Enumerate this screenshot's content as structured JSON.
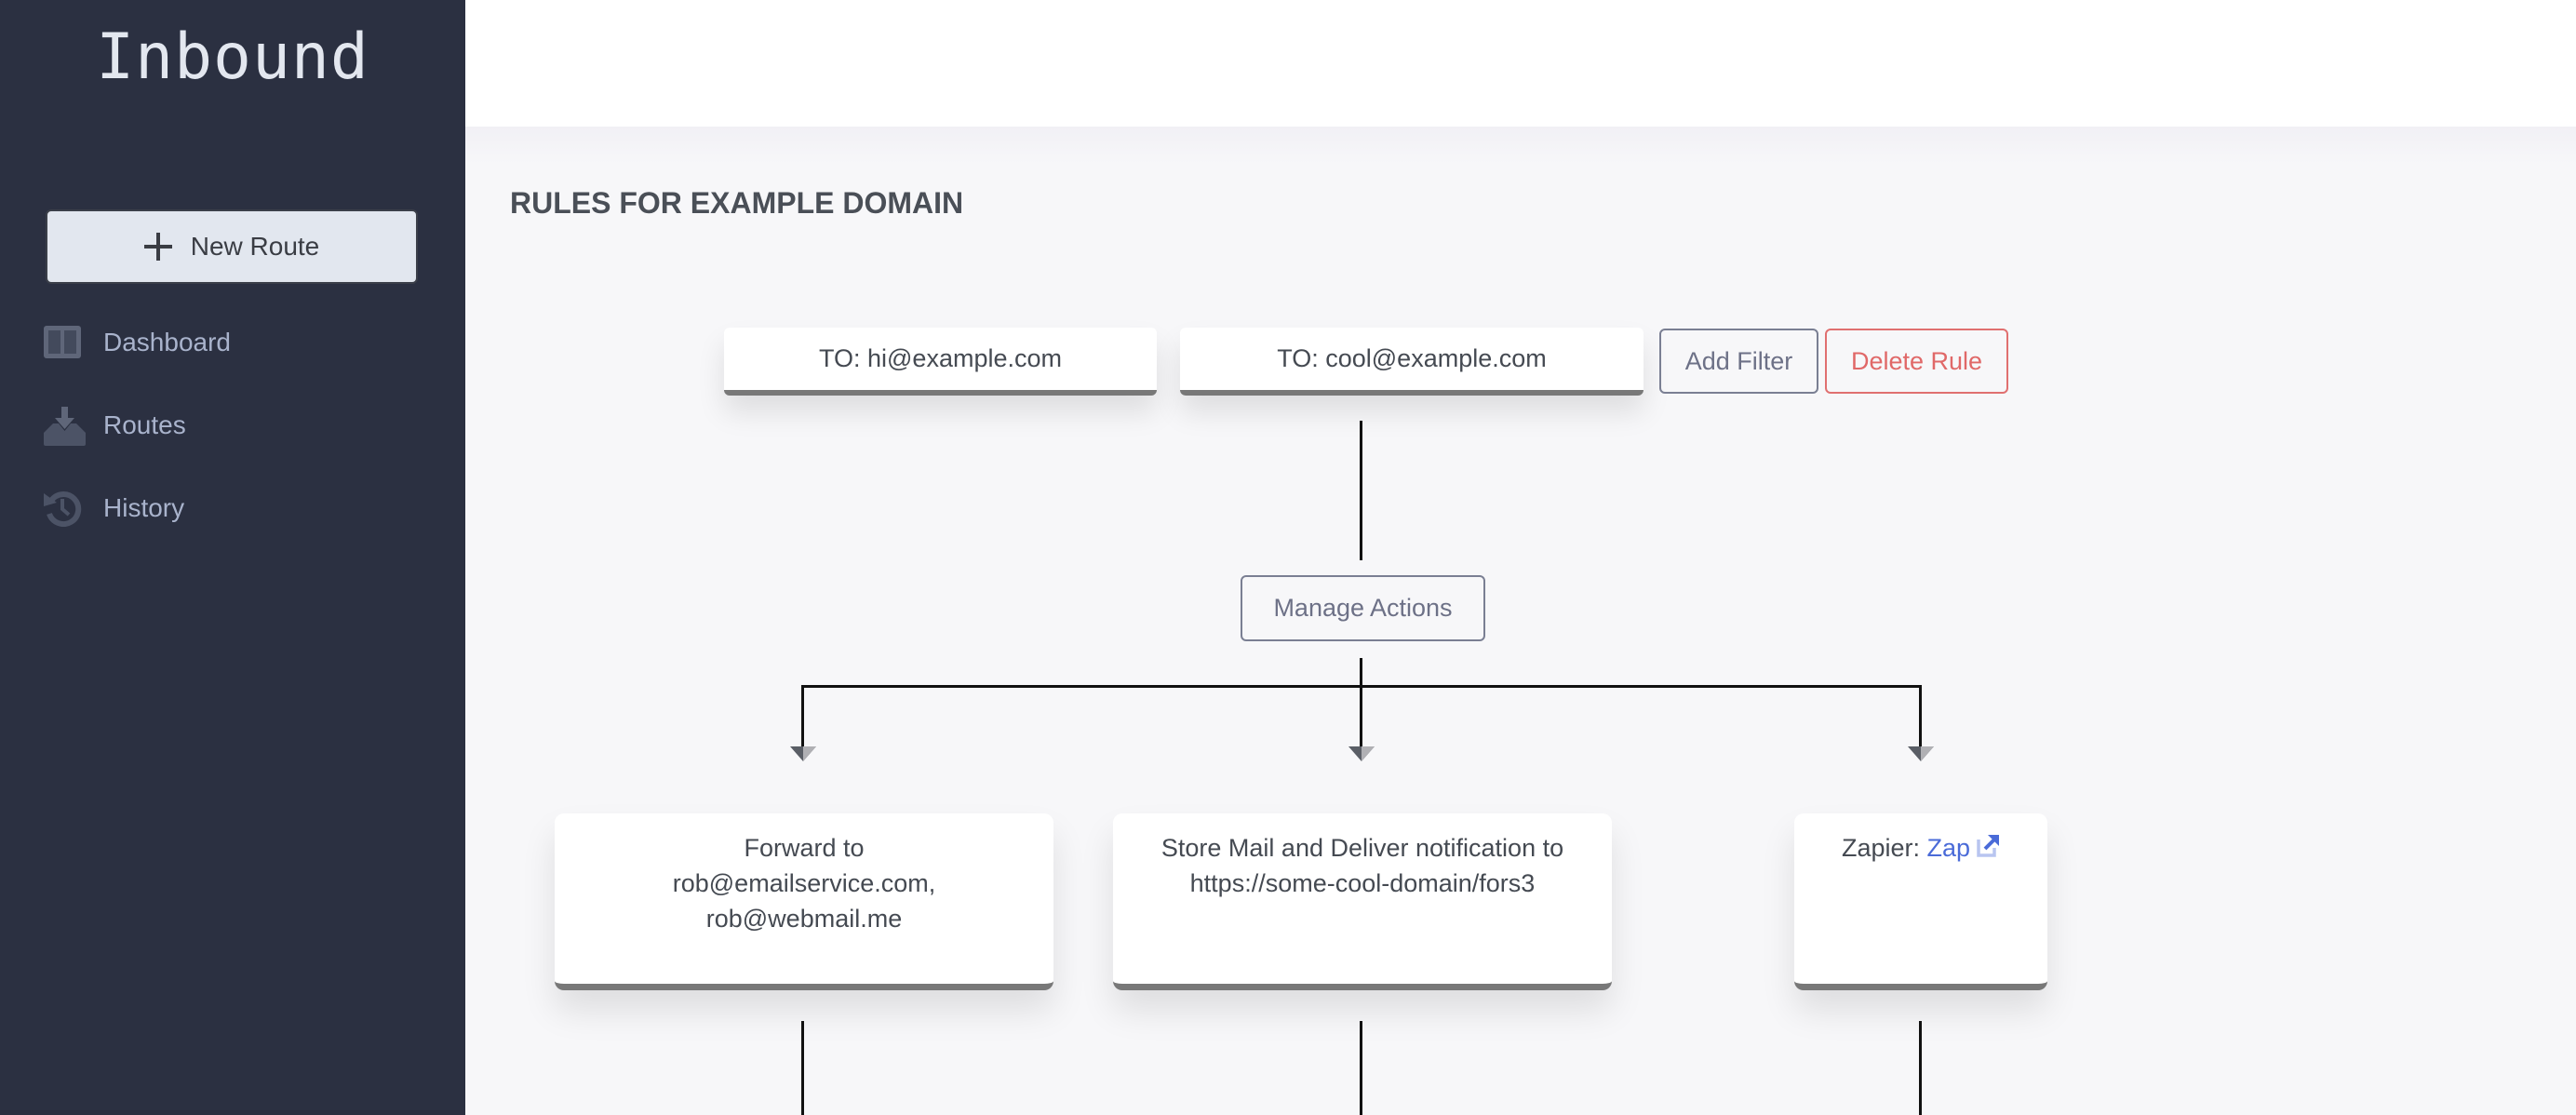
{
  "sidebar": {
    "brand": "Inbound",
    "new_route_label": "New Route",
    "items": [
      {
        "label": "Dashboard",
        "icon": "dashboard-icon"
      },
      {
        "label": "Routes",
        "icon": "inbox-download-icon"
      },
      {
        "label": "History",
        "icon": "history-icon"
      }
    ]
  },
  "main": {
    "title": "RULES FOR EXAMPLE DOMAIN",
    "filters": [
      {
        "label": "TO: hi@example.com"
      },
      {
        "label": "TO: cool@example.com"
      }
    ],
    "add_filter_label": "Add Filter",
    "delete_rule_label": "Delete Rule",
    "manage_actions_label": "Manage Actions",
    "actions": [
      {
        "text": "Forward to rob@emailservice.com, rob@webmail.me"
      },
      {
        "text": "Store Mail and Deliver notification to https://some-cool-domain/fors3"
      },
      {
        "prefix": "Zapier:",
        "link_label": "Zap",
        "icon": "external-link-icon"
      }
    ]
  },
  "colors": {
    "sidebar_bg": "#2b3041",
    "danger": "#e06868",
    "link": "#4a6bd8"
  }
}
